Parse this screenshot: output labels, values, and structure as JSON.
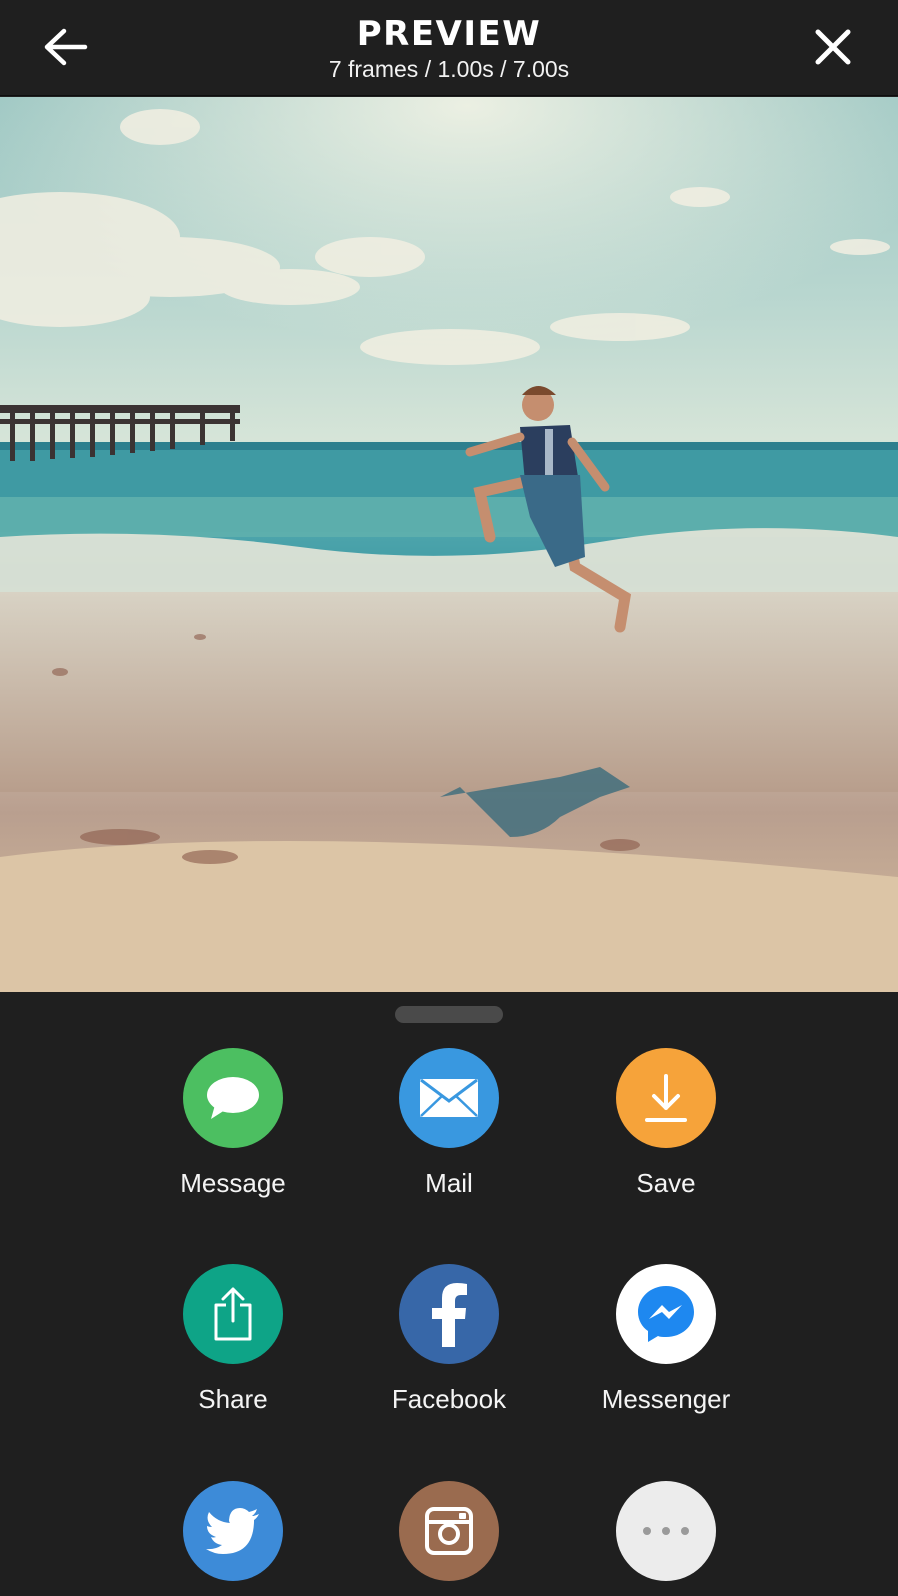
{
  "header": {
    "title": "PREVIEW",
    "subtitle": "7 frames / 1.00s / 7.00s",
    "back_icon": "arrow-left-icon",
    "close_icon": "close-icon"
  },
  "preview": {
    "scene_colors": {
      "sky": "#b8d6cf",
      "sea": "#3f9aa3",
      "sand": "#c8ae96"
    }
  },
  "share_options": [
    {
      "label": "Message",
      "icon": "message-bubble-icon",
      "color": "#4cbf61"
    },
    {
      "label": "Mail",
      "icon": "envelope-icon",
      "color": "#3998e0"
    },
    {
      "label": "Save",
      "icon": "download-icon",
      "color": "#f6a33a"
    },
    {
      "label": "Share",
      "icon": "share-icon",
      "color": "#0ea487"
    },
    {
      "label": "Facebook",
      "icon": "facebook-icon",
      "color": "#3767a8"
    },
    {
      "label": "Messenger",
      "icon": "messenger-icon",
      "color": "#ffffff"
    },
    {
      "label": "",
      "icon": "twitter-icon",
      "color": "#3d8bd8"
    },
    {
      "label": "",
      "icon": "instagram-icon",
      "color": "#9a6b4f"
    },
    {
      "label": "",
      "icon": "more-icon",
      "color": "#ececec"
    }
  ]
}
